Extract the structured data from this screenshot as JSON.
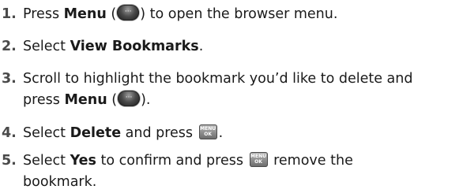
{
  "steps": [
    {
      "num": "1.",
      "t1": "Press ",
      "b1": "Menu",
      "t2": " (",
      "t3": ") to open the browser menu."
    },
    {
      "num": "2.",
      "t1": "Select ",
      "b1": "View Bookmarks",
      "t2": "."
    },
    {
      "num": "3.",
      "line1": "Scroll to highlight the bookmark you’d like to delete and",
      "t1": "press ",
      "b1": "Menu",
      "t2": " (",
      "t3": ")."
    },
    {
      "num": "4.",
      "t1": "Select ",
      "b1": "Delete",
      "t2": " and press ",
      "t3": "."
    },
    {
      "num": "5.",
      "t1": "Select ",
      "b1": "Yes",
      "t2": " to confirm and press ",
      "t3": " remove the",
      "line2": "bookmark."
    }
  ],
  "icons": {
    "menu_key": "menu-key-icon",
    "menu_key_glyph": "···",
    "ok_key": "menu-ok-key-icon",
    "ok_key_top": "MENU",
    "ok_key_bottom": "OK"
  }
}
